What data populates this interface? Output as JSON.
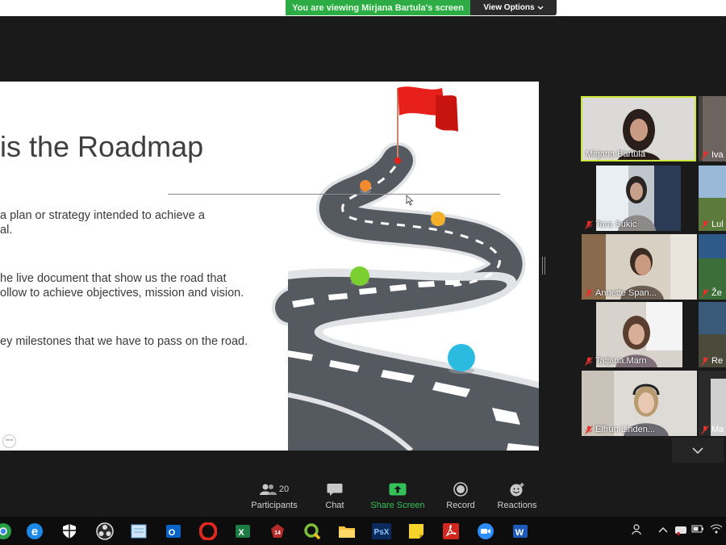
{
  "banner": {
    "sharing_text": "You are viewing Mirjana Bartula's screen",
    "view_options_label": "View Options",
    "view_options_icon": "chevron-down-icon"
  },
  "slide": {
    "title": "is the Roadmap",
    "bullets": [
      "a plan or strategy intended to achieve a",
      "al.",
      "he live document that show us the road that",
      "ollow to achieve objectives, mission and vision.",
      "ey milestones that we have to pass on the road."
    ],
    "colors": {
      "flag": "#e8201c",
      "road": "#555a60",
      "milestone_orange": "#f28a30",
      "milestone_yellow": "#f5b02a",
      "milestone_green": "#7ccf30",
      "milestone_blue": "#2bbbe0"
    }
  },
  "gallery": {
    "participants": [
      {
        "name": "Mirjana Bartula",
        "muted": false,
        "active_speaker": true
      },
      {
        "name": "Tara Sukic",
        "muted": true,
        "active_speaker": false
      },
      {
        "name": "Annette Span...",
        "muted": true,
        "active_speaker": false
      },
      {
        "name": "Tatjana.Marn",
        "muted": true,
        "active_speaker": false
      },
      {
        "name": "Elfrun Linden...",
        "muted": true,
        "active_speaker": false
      }
    ],
    "side_participants": [
      "Iva",
      "Lul",
      "Že",
      "Re",
      "Ma"
    ],
    "active_speaker_border": "#c8e63c"
  },
  "toolbar": {
    "participants_label": "Participants",
    "participants_count": "20",
    "chat_label": "Chat",
    "share_label": "Share Screen",
    "record_label": "Record",
    "reactions_label": "Reactions",
    "share_color": "#33c158"
  },
  "taskbar": {
    "icons": [
      "chrome-icon",
      "edge-icon",
      "security-icon",
      "obs-icon",
      "notepad-icon",
      "outlook-icon",
      "opera-icon",
      "excel-icon",
      "app-icon",
      "qgis-icon",
      "file-explorer-icon",
      "photoshop-express-icon",
      "sticky-notes-icon",
      "acrobat-icon",
      "zoom-icon",
      "word-icon"
    ],
    "photoshop_label": "PsX"
  }
}
